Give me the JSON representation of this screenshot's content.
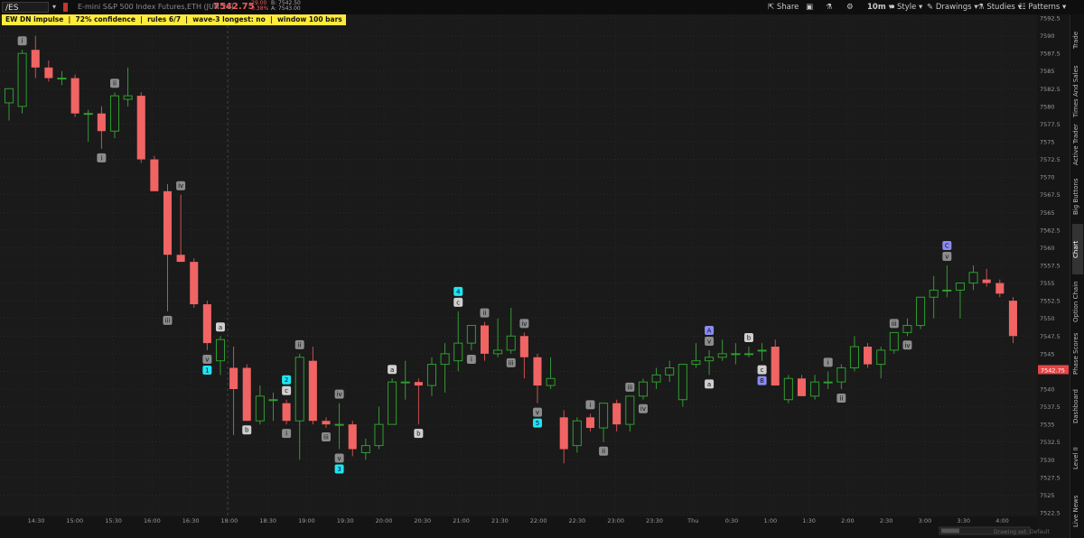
{
  "toolbar": {
    "symbol": "/ES",
    "description": "E-mini S&P 500 Index Futures,ETH (JUN 26)",
    "last_price": "7542.75",
    "change": "-29.00",
    "change_pct": "-0.38%",
    "bid": "B: 7542.50",
    "ask": "A: 7543.00",
    "share_label": "Share",
    "timeframe_label": "10m",
    "style_label": "Style",
    "drawings_label": "Drawings",
    "studies_label": "Studies",
    "patterns_label": "Patterns"
  },
  "sidebar_tabs": [
    "Trade",
    "Times And Sales",
    "Active Trader",
    "Big Buttons",
    "Chart",
    "Option Chain",
    "Phase Scores",
    "Dashboard",
    "Level II",
    "Live News"
  ],
  "sidebar_active": "Chart",
  "banner": {
    "text": "EW DN impulse  |  72% confidence  |  rules 6/7  |  wave-3 longest: no  |  window 100 bars"
  },
  "colors": {
    "up": "#2e9e2e",
    "down": "#f06464",
    "label_grey": "#8c8c8c",
    "label_light": "#cfcfcf",
    "label_cyan": "#1fe5f0",
    "label_purple": "#8a8cf0",
    "price_badge": "#e64545"
  },
  "chart_data": {
    "type": "candlestick",
    "ylim": [
      7522.5,
      7592.5
    ],
    "y_ticks": [
      "7592.5",
      "7590",
      "7587.5",
      "7585",
      "7582.5",
      "7580",
      "7577.5",
      "7575",
      "7572.5",
      "7570",
      "7567.5",
      "7565",
      "7562.5",
      "7560",
      "7557.5",
      "7555",
      "7552.5",
      "7550",
      "7547.5",
      "7545",
      "7542.5",
      "7540",
      "7537.5",
      "7535",
      "7532.5",
      "7530",
      "7527.5",
      "7525",
      "7522.5"
    ],
    "x_labels": [
      "14:30",
      "15:00",
      "15:30",
      "16:00",
      "16:30",
      "18:00",
      "18:30",
      "19:00",
      "19:30",
      "20:00",
      "20:30",
      "21:00",
      "21:30",
      "22:00",
      "22:30",
      "23:00",
      "23:30",
      "Thu",
      "0:30",
      "1:00",
      "1:30",
      "2:00",
      "2:30",
      "3:00",
      "3:30",
      "4:00"
    ],
    "last_price_label": "7542.75",
    "candles": [
      {
        "o": 7580.5,
        "h": 7582.5,
        "l": 7578,
        "c": 7582.5
      },
      {
        "o": 7580,
        "h": 7588,
        "l": 7579,
        "c": 7587.5
      },
      {
        "o": 7588,
        "h": 7590,
        "l": 7584,
        "c": 7585.5
      },
      {
        "o": 7585.5,
        "h": 7586.5,
        "l": 7583.5,
        "c": 7584
      },
      {
        "o": 7584,
        "h": 7585,
        "l": 7583,
        "c": 7584
      },
      {
        "o": 7584,
        "h": 7584.5,
        "l": 7578.5,
        "c": 7579
      },
      {
        "o": 7579,
        "h": 7579.5,
        "l": 7575,
        "c": 7579
      },
      {
        "o": 7579,
        "h": 7580,
        "l": 7574,
        "c": 7576.5
      },
      {
        "o": 7576.5,
        "h": 7582,
        "l": 7575.5,
        "c": 7581.5
      },
      {
        "o": 7581,
        "h": 7585.5,
        "l": 7580,
        "c": 7581.5
      },
      {
        "o": 7581.5,
        "h": 7582,
        "l": 7572,
        "c": 7572.5
      },
      {
        "o": 7572.5,
        "h": 7573,
        "l": 7568,
        "c": 7568
      },
      {
        "o": 7568,
        "h": 7569,
        "l": 7551,
        "c": 7559
      },
      {
        "o": 7559,
        "h": 7567.5,
        "l": 7558,
        "c": 7558
      },
      {
        "o": 7558,
        "h": 7558.5,
        "l": 7551.5,
        "c": 7552
      },
      {
        "o": 7552,
        "h": 7552.5,
        "l": 7545.5,
        "c": 7546.5
      },
      {
        "o": 7544,
        "h": 7547.5,
        "l": 7542,
        "c": 7547
      },
      {
        "o": 7543,
        "h": 7546,
        "l": 7533.5,
        "c": 7540
      },
      {
        "o": 7543,
        "h": 7543.5,
        "l": 7535.5,
        "c": 7535.5
      },
      {
        "o": 7535.5,
        "h": 7540.5,
        "l": 7535,
        "c": 7539
      },
      {
        "o": 7538.5,
        "h": 7539.5,
        "l": 7535.5,
        "c": 7538.5
      },
      {
        "o": 7538,
        "h": 7538.5,
        "l": 7535,
        "c": 7535.5
      },
      {
        "o": 7535.5,
        "h": 7545,
        "l": 7530,
        "c": 7544.5
      },
      {
        "o": 7544,
        "h": 7546,
        "l": 7535,
        "c": 7535.5
      },
      {
        "o": 7535.5,
        "h": 7536,
        "l": 7534.5,
        "c": 7535
      },
      {
        "o": 7535,
        "h": 7538,
        "l": 7531.5,
        "c": 7535
      },
      {
        "o": 7535,
        "h": 7535.5,
        "l": 7530.5,
        "c": 7531.5
      },
      {
        "o": 7531,
        "h": 7533,
        "l": 7530,
        "c": 7532
      },
      {
        "o": 7532,
        "h": 7537.5,
        "l": 7531.5,
        "c": 7535
      },
      {
        "o": 7535,
        "h": 7541.5,
        "l": 7535,
        "c": 7541
      },
      {
        "o": 7541,
        "h": 7544,
        "l": 7538.5,
        "c": 7541
      },
      {
        "o": 7541,
        "h": 7541.5,
        "l": 7535,
        "c": 7540.5
      },
      {
        "o": 7540.5,
        "h": 7544.5,
        "l": 7539,
        "c": 7543.5
      },
      {
        "o": 7543.5,
        "h": 7546.5,
        "l": 7539.5,
        "c": 7545
      },
      {
        "o": 7544,
        "h": 7551,
        "l": 7542.5,
        "c": 7546.5
      },
      {
        "o": 7546.5,
        "h": 7549,
        "l": 7545.5,
        "c": 7549
      },
      {
        "o": 7549,
        "h": 7549.5,
        "l": 7544,
        "c": 7545
      },
      {
        "o": 7545,
        "h": 7550,
        "l": 7544.5,
        "c": 7545.5
      },
      {
        "o": 7545.5,
        "h": 7551.5,
        "l": 7545,
        "c": 7547.5
      },
      {
        "o": 7547.5,
        "h": 7548,
        "l": 7541.5,
        "c": 7544.5
      },
      {
        "o": 7544.5,
        "h": 7545,
        "l": 7538,
        "c": 7540.5
      },
      {
        "o": 7540.5,
        "h": 7544.5,
        "l": 7540,
        "c": 7541.5
      },
      {
        "o": 7536,
        "h": 7537,
        "l": 7529.5,
        "c": 7531.5
      },
      {
        "o": 7532,
        "h": 7536,
        "l": 7531,
        "c": 7535.5
      },
      {
        "o": 7536,
        "h": 7536.5,
        "l": 7534,
        "c": 7534.5
      },
      {
        "o": 7534.5,
        "h": 7538,
        "l": 7532.5,
        "c": 7538
      },
      {
        "o": 7538,
        "h": 7538.5,
        "l": 7534,
        "c": 7535
      },
      {
        "o": 7535,
        "h": 7539,
        "l": 7534,
        "c": 7539
      },
      {
        "o": 7539,
        "h": 7541.5,
        "l": 7538.5,
        "c": 7541
      },
      {
        "o": 7541,
        "h": 7543,
        "l": 7540,
        "c": 7542
      },
      {
        "o": 7542,
        "h": 7544,
        "l": 7541,
        "c": 7543
      },
      {
        "o": 7538.5,
        "h": 7540,
        "l": 7537.5,
        "c": 7543.5
      },
      {
        "o": 7543.5,
        "h": 7546.5,
        "l": 7543,
        "c": 7544
      },
      {
        "o": 7544,
        "h": 7545.5,
        "l": 7542,
        "c": 7544.5
      },
      {
        "o": 7544.5,
        "h": 7547,
        "l": 7544,
        "c": 7545
      },
      {
        "o": 7545,
        "h": 7546.5,
        "l": 7543.5,
        "c": 7545
      },
      {
        "o": 7545,
        "h": 7546,
        "l": 7544.5,
        "c": 7545
      },
      {
        "o": 7545.5,
        "h": 7546.5,
        "l": 7544,
        "c": 7545.5
      },
      {
        "o": 7546,
        "h": 7547,
        "l": 7540.5,
        "c": 7540.5
      },
      {
        "o": 7538.5,
        "h": 7542,
        "l": 7538,
        "c": 7541.5
      },
      {
        "o": 7541.5,
        "h": 7542,
        "l": 7539,
        "c": 7539
      },
      {
        "o": 7539,
        "h": 7542,
        "l": 7538.5,
        "c": 7541
      },
      {
        "o": 7541,
        "h": 7542.5,
        "l": 7540,
        "c": 7541
      },
      {
        "o": 7541,
        "h": 7543.5,
        "l": 7540,
        "c": 7543
      },
      {
        "o": 7543,
        "h": 7547.5,
        "l": 7542.5,
        "c": 7546
      },
      {
        "o": 7546,
        "h": 7546.5,
        "l": 7543,
        "c": 7543.5
      },
      {
        "o": 7543.5,
        "h": 7546,
        "l": 7541.5,
        "c": 7545.5
      },
      {
        "o": 7545.5,
        "h": 7548,
        "l": 7545,
        "c": 7548
      },
      {
        "o": 7548,
        "h": 7550,
        "l": 7547.5,
        "c": 7549
      },
      {
        "o": 7549,
        "h": 7552,
        "l": 7548.5,
        "c": 7553
      },
      {
        "o": 7553,
        "h": 7556,
        "l": 7550,
        "c": 7554
      },
      {
        "o": 7554,
        "h": 7557.5,
        "l": 7553,
        "c": 7554
      },
      {
        "o": 7554,
        "h": 7555,
        "l": 7550,
        "c": 7555
      },
      {
        "o": 7555,
        "h": 7557.5,
        "l": 7554,
        "c": 7556.5
      },
      {
        "o": 7555.5,
        "h": 7557,
        "l": 7554.5,
        "c": 7555
      },
      {
        "o": 7555,
        "h": 7555.5,
        "l": 7553,
        "c": 7553.5
      },
      {
        "o": 7552.5,
        "h": 7553,
        "l": 7546.5,
        "c": 7547.5
      }
    ],
    "wave_labels": [
      {
        "i": 1,
        "text": "i",
        "style": "grey",
        "pos": "above"
      },
      {
        "i": 7,
        "text": "i",
        "style": "grey",
        "pos": "below"
      },
      {
        "i": 8,
        "text": "ii",
        "style": "grey",
        "pos": "above"
      },
      {
        "i": 12,
        "text": "iii",
        "style": "grey",
        "pos": "below"
      },
      {
        "i": 13,
        "text": "iv",
        "style": "grey",
        "pos": "above"
      },
      {
        "i": 16,
        "text": "a",
        "style": "light",
        "pos": "above"
      },
      {
        "i": 15,
        "text": "v",
        "style": "grey",
        "pos": "below"
      },
      {
        "i": 15,
        "text": "1",
        "style": "cyan",
        "pos": "below2"
      },
      {
        "i": 18,
        "text": "b",
        "style": "light",
        "pos": "below"
      },
      {
        "i": 21,
        "text": "2",
        "style": "cyan",
        "pos": "above2"
      },
      {
        "i": 21,
        "text": "c",
        "style": "light",
        "pos": "above"
      },
      {
        "i": 21,
        "text": "i",
        "style": "grey",
        "pos": "below"
      },
      {
        "i": 22,
        "text": "ii",
        "style": "grey",
        "pos": "above"
      },
      {
        "i": 25,
        "text": "iv",
        "style": "grey",
        "pos": "above"
      },
      {
        "i": 24,
        "text": "iii",
        "style": "grey",
        "pos": "below"
      },
      {
        "i": 25,
        "text": "v",
        "style": "grey",
        "pos": "below"
      },
      {
        "i": 25,
        "text": "3",
        "style": "cyan",
        "pos": "below2"
      },
      {
        "i": 29,
        "text": "a",
        "style": "light",
        "pos": "above"
      },
      {
        "i": 31,
        "text": "b",
        "style": "light",
        "pos": "below"
      },
      {
        "i": 34,
        "text": "4",
        "style": "cyan",
        "pos": "above2"
      },
      {
        "i": 34,
        "text": "c",
        "style": "light",
        "pos": "above"
      },
      {
        "i": 35,
        "text": "i",
        "style": "grey",
        "pos": "below"
      },
      {
        "i": 36,
        "text": "ii",
        "style": "grey",
        "pos": "above"
      },
      {
        "i": 38,
        "text": "iii",
        "style": "grey",
        "pos": "below"
      },
      {
        "i": 39,
        "text": "iv",
        "style": "grey",
        "pos": "above"
      },
      {
        "i": 40,
        "text": "v",
        "style": "grey",
        "pos": "below"
      },
      {
        "i": 40,
        "text": "5",
        "style": "cyan",
        "pos": "below2"
      },
      {
        "i": 44,
        "text": "i",
        "style": "grey",
        "pos": "above"
      },
      {
        "i": 45,
        "text": "ii",
        "style": "grey",
        "pos": "below"
      },
      {
        "i": 47,
        "text": "iii",
        "style": "grey",
        "pos": "above"
      },
      {
        "i": 48,
        "text": "iv",
        "style": "grey",
        "pos": "below"
      },
      {
        "i": 53,
        "text": "A",
        "style": "purple",
        "pos": "above2"
      },
      {
        "i": 53,
        "text": "v",
        "style": "grey",
        "pos": "above"
      },
      {
        "i": 53,
        "text": "a",
        "style": "light",
        "pos": "below"
      },
      {
        "i": 56,
        "text": "b",
        "style": "light",
        "pos": "above"
      },
      {
        "i": 57,
        "text": "c",
        "style": "light",
        "pos": "below"
      },
      {
        "i": 57,
        "text": "B",
        "style": "purple",
        "pos": "below2"
      },
      {
        "i": 62,
        "text": "i",
        "style": "grey",
        "pos": "above"
      },
      {
        "i": 63,
        "text": "ii",
        "style": "grey",
        "pos": "below"
      },
      {
        "i": 67,
        "text": "iii",
        "style": "grey",
        "pos": "above"
      },
      {
        "i": 68,
        "text": "iv",
        "style": "grey",
        "pos": "below"
      },
      {
        "i": 71,
        "text": "C",
        "style": "purple",
        "pos": "above2"
      },
      {
        "i": 71,
        "text": "v",
        "style": "grey",
        "pos": "above"
      }
    ]
  },
  "bottom_hint": "Drawing set: Default"
}
